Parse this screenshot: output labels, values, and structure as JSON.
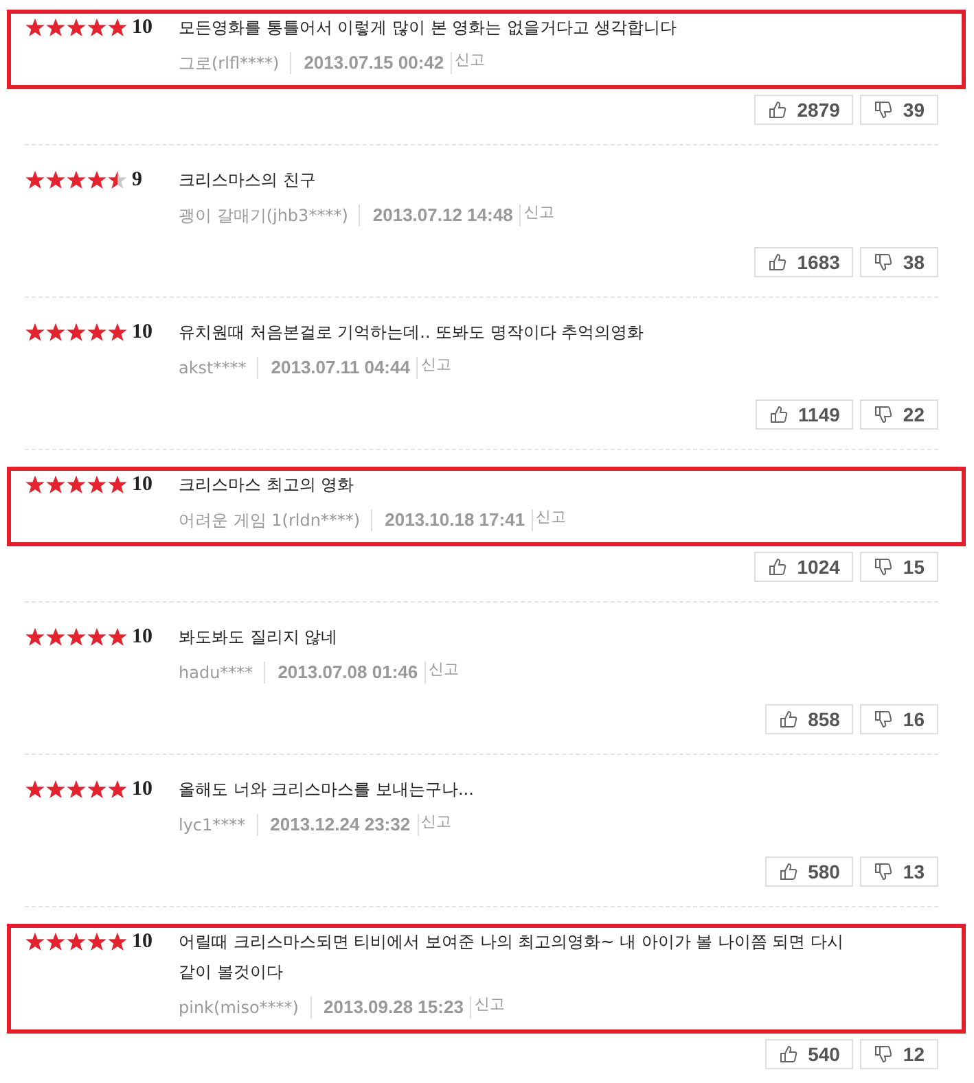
{
  "reviews": [
    {
      "stars": 5,
      "score": "10",
      "text": "모든영화를 통틀어서 이렇게 많이 본 영화는 없을거다고 생각합니다",
      "author": "그로(rlfl****)",
      "date": "2013.07.15 00:42",
      "report": "신고",
      "likes": "2879",
      "dislikes": "39",
      "highlighted": true
    },
    {
      "stars": 4.5,
      "score": "9",
      "text": "크리스마스의 친구",
      "author": "괭이 갈매기(jhb3****)",
      "date": "2013.07.12 14:48",
      "report": "신고",
      "likes": "1683",
      "dislikes": "38",
      "highlighted": false
    },
    {
      "stars": 5,
      "score": "10",
      "text": "유치원때 처음본걸로 기억하는데.. 또봐도 명작이다 추억의영화",
      "author": "akst****",
      "date": "2013.07.11 04:44",
      "report": "신고",
      "likes": "1149",
      "dislikes": "22",
      "highlighted": false
    },
    {
      "stars": 5,
      "score": "10",
      "text": "크리스마스 최고의 영화",
      "author": "어려운 게임 1(rldn****)",
      "date": "2013.10.18 17:41",
      "report": "신고",
      "likes": "1024",
      "dislikes": "15",
      "highlighted": true
    },
    {
      "stars": 5,
      "score": "10",
      "text": "봐도봐도 질리지 않네",
      "author": "hadu****",
      "date": "2013.07.08 01:46",
      "report": "신고",
      "likes": "858",
      "dislikes": "16",
      "highlighted": false
    },
    {
      "stars": 5,
      "score": "10",
      "text": "올해도 너와 크리스마스를 보내는구나...",
      "author": "lyc1****",
      "date": "2013.12.24 23:32",
      "report": "신고",
      "likes": "580",
      "dislikes": "13",
      "highlighted": false
    },
    {
      "stars": 5,
      "score": "10",
      "text": "어릴때 크리스마스되면 티비에서 보여준 나의 최고의영화~ 내 아이가 볼 나이쯤 되면 다시 같이 볼것이다",
      "author": "pink(miso****)",
      "date": "2013.09.28 15:23",
      "report": "신고",
      "likes": "540",
      "dislikes": "12",
      "highlighted": true
    }
  ]
}
